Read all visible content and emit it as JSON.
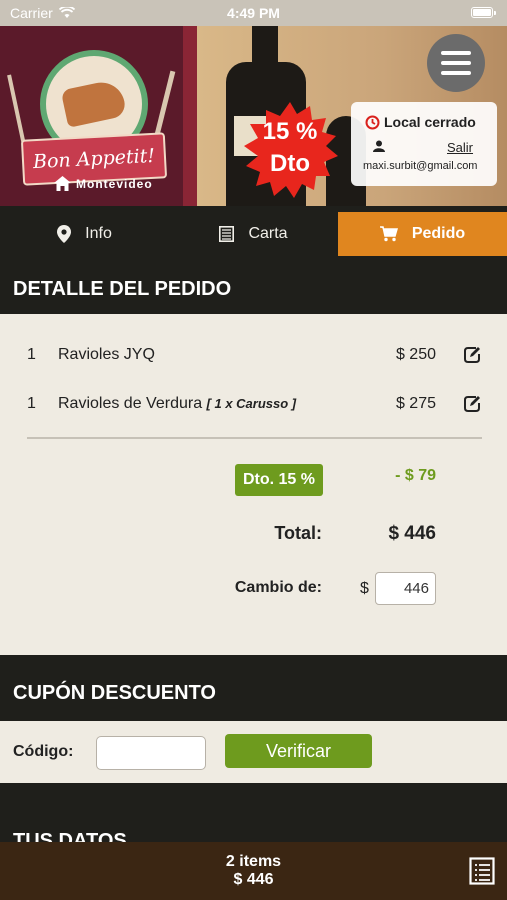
{
  "status_bar": {
    "carrier": "Carrier",
    "time": "4:49 PM"
  },
  "header": {
    "brand": "Bon Appetit!",
    "location": "Montevideo",
    "discount_badge": {
      "line1": "15 %",
      "line2": "Dto"
    },
    "store_status": "Local cerrado",
    "logout_label": "Salir",
    "user_email": "maxi.surbit@gmail.com"
  },
  "tabs": [
    {
      "label": "Info",
      "icon": "location-pin-icon",
      "active": false
    },
    {
      "label": "Carta",
      "icon": "menu-list-icon",
      "active": false
    },
    {
      "label": "Pedido",
      "icon": "cart-icon",
      "active": true
    }
  ],
  "order": {
    "title": "DETALLE DEL PEDIDO",
    "items": [
      {
        "qty": "1",
        "name": "Ravioles JYQ",
        "extra": "",
        "price": "$ 250"
      },
      {
        "qty": "1",
        "name": "Ravioles de Verdura",
        "extra": "[ 1 x Carusso ]",
        "price": "$ 275"
      }
    ],
    "discount_label": "Dto. 15 %",
    "discount_value": "- $ 79",
    "total_label": "Total:",
    "total_value": "$ 446",
    "change_label": "Cambio de:",
    "change_currency": "$",
    "change_value": "446"
  },
  "coupon": {
    "title": "CUPÓN DESCUENTO",
    "code_label": "Código:",
    "code_value": "",
    "verify_label": "Verificar"
  },
  "next_section_title": "TUS DATOS",
  "footer": {
    "items_count": "2 items",
    "total": "$ 446"
  },
  "colors": {
    "accent_orange": "#e0861f",
    "accent_green": "#6e9b1e",
    "dark": "#1f1f1b",
    "panel": "#efebe2",
    "footer": "#3b2613"
  }
}
